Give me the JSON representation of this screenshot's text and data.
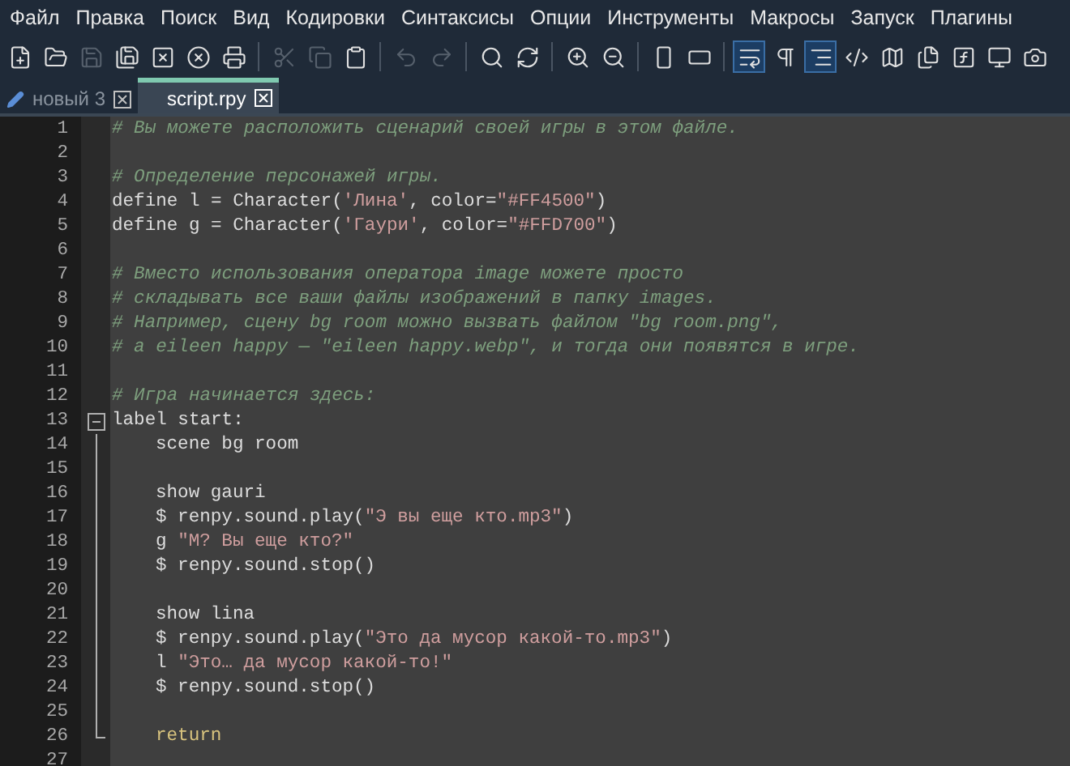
{
  "menu": [
    "Файл",
    "Правка",
    "Поиск",
    "Вид",
    "Кодировки",
    "Синтаксисы",
    "Опции",
    "Инструменты",
    "Макросы",
    "Запуск",
    "Плагины"
  ],
  "toolbar": [
    {
      "disabled": false,
      "on": false
    },
    {
      "disabled": false,
      "on": false
    },
    {
      "disabled": true,
      "on": false
    },
    {
      "disabled": false,
      "on": false
    },
    {
      "disabled": false,
      "on": false
    },
    {
      "disabled": false,
      "on": false
    },
    {
      "disabled": false,
      "on": false,
      "group_end": true
    },
    {
      "disabled": true,
      "on": false
    },
    {
      "disabled": true,
      "on": false
    },
    {
      "disabled": false,
      "on": false,
      "group_end": true
    },
    {
      "disabled": true,
      "on": false
    },
    {
      "disabled": true,
      "on": false,
      "group_end": true
    },
    {
      "disabled": false,
      "on": false
    },
    {
      "disabled": false,
      "on": false,
      "group_end": true
    },
    {
      "disabled": false,
      "on": false
    },
    {
      "disabled": false,
      "on": false,
      "group_end": true
    },
    {
      "disabled": false,
      "on": false
    },
    {
      "disabled": false,
      "on": false,
      "group_end": true
    },
    {
      "disabled": false,
      "on": true
    },
    {
      "disabled": false,
      "on": false
    },
    {
      "disabled": false,
      "on": true
    },
    {
      "disabled": false,
      "on": false
    },
    {
      "disabled": false,
      "on": false
    },
    {
      "disabled": false,
      "on": false
    },
    {
      "disabled": false,
      "on": false
    },
    {
      "disabled": false,
      "on": false
    },
    {
      "disabled": false,
      "on": false
    }
  ],
  "tabs": [
    {
      "label": "новый 3",
      "selected": false,
      "modified": true
    },
    {
      "label": "script.rpy",
      "selected": true,
      "modified": false
    }
  ],
  "lines": [
    {
      "number": "1",
      "tokens": [
        {
          "kind": "comment",
          "text": "# Вы можете расположить сценарий своей игры в этом файле."
        }
      ]
    },
    {
      "number": "2"
    },
    {
      "number": "3",
      "tokens": [
        {
          "kind": "comment",
          "text": "# Определение персонажей игры."
        }
      ]
    },
    {
      "number": "4",
      "tokens": [
        {
          "kind": "plain",
          "text": "define l = Character("
        },
        {
          "kind": "string",
          "text": "'Лина'"
        },
        {
          "kind": "plain",
          "text": ", color="
        },
        {
          "kind": "string",
          "text": "\"#FF4500\""
        },
        {
          "kind": "plain",
          "text": ")"
        }
      ]
    },
    {
      "number": "5",
      "tokens": [
        {
          "kind": "plain",
          "text": "define g = Character("
        },
        {
          "kind": "string",
          "text": "'Гаури'"
        },
        {
          "kind": "plain",
          "text": ", color="
        },
        {
          "kind": "string",
          "text": "\"#FFD700\""
        },
        {
          "kind": "plain",
          "text": ")"
        }
      ]
    },
    {
      "number": "6"
    },
    {
      "number": "7",
      "tokens": [
        {
          "kind": "comment",
          "text": "# Вместо использования оператора image можете просто"
        }
      ]
    },
    {
      "number": "8",
      "tokens": [
        {
          "kind": "comment",
          "text": "# складывать все ваши файлы изображений в папку images."
        }
      ]
    },
    {
      "number": "9",
      "tokens": [
        {
          "kind": "comment",
          "text": "# Например, сцену bg room можно вызвать файлом \"bg room.png\","
        }
      ]
    },
    {
      "number": "10",
      "tokens": [
        {
          "kind": "comment",
          "text": "# а eileen happy — \"eileen happy.webp\", и тогда они появятся в игре."
        }
      ]
    },
    {
      "number": "11"
    },
    {
      "number": "12",
      "tokens": [
        {
          "kind": "comment",
          "text": "# Игра начинается здесь:"
        }
      ]
    },
    {
      "number": "13",
      "fold_open": true,
      "tokens": [
        {
          "kind": "plain",
          "text": "label start:"
        }
      ]
    },
    {
      "number": "14",
      "in_block": true,
      "indented": true,
      "tokens": [
        {
          "kind": "plain",
          "text": "scene bg room"
        }
      ]
    },
    {
      "number": "15",
      "in_block": true
    },
    {
      "number": "16",
      "in_block": true,
      "indented": true,
      "tokens": [
        {
          "kind": "plain",
          "text": "show gauri"
        }
      ]
    },
    {
      "number": "17",
      "in_block": true,
      "indented": true,
      "tokens": [
        {
          "kind": "plain",
          "text": "$ renpy.sound.play("
        },
        {
          "kind": "string",
          "text": "\"Э вы еще кто.mp3\""
        },
        {
          "kind": "plain",
          "text": ")"
        }
      ]
    },
    {
      "number": "18",
      "in_block": true,
      "indented": true,
      "tokens": [
        {
          "kind": "plain",
          "text": "g "
        },
        {
          "kind": "string",
          "text": "\"М? Вы еще кто?\""
        }
      ]
    },
    {
      "number": "19",
      "in_block": true,
      "indented": true,
      "tokens": [
        {
          "kind": "plain",
          "text": "$ renpy.sound.stop()"
        }
      ]
    },
    {
      "number": "20",
      "in_block": true
    },
    {
      "number": "21",
      "in_block": true,
      "indented": true,
      "tokens": [
        {
          "kind": "plain",
          "text": "show lina"
        }
      ]
    },
    {
      "number": "22",
      "in_block": true,
      "indented": true,
      "tokens": [
        {
          "kind": "plain",
          "text": "$ renpy.sound.play("
        },
        {
          "kind": "string",
          "text": "\"Это да мусор какой-то.mp3\""
        },
        {
          "kind": "plain",
          "text": ")"
        }
      ]
    },
    {
      "number": "23",
      "in_block": true,
      "indented": true,
      "tokens": [
        {
          "kind": "plain",
          "text": "l "
        },
        {
          "kind": "string",
          "text": "\"Это… да мусор какой-то!\""
        }
      ]
    },
    {
      "number": "24",
      "in_block": true,
      "indented": true,
      "tokens": [
        {
          "kind": "plain",
          "text": "$ renpy.sound.stop()"
        }
      ]
    },
    {
      "number": "25",
      "in_block": true
    },
    {
      "number": "26",
      "in_block": true,
      "block_end": true,
      "indented": true,
      "tokens": [
        {
          "kind": "keyword",
          "text": "return"
        }
      ]
    },
    {
      "number": "27"
    }
  ]
}
